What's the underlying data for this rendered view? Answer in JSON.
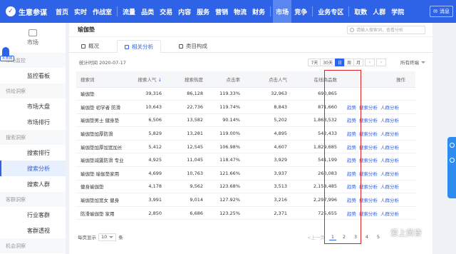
{
  "topnav": {
    "logo": "生意参谋",
    "items": [
      "首页",
      "实时",
      "作战室",
      "流量",
      "品类",
      "交易",
      "内容",
      "服务",
      "营销",
      "物流",
      "财务",
      "市场",
      "竞争",
      "业务专区",
      "取数",
      "人群",
      "学院"
    ],
    "active": "市场",
    "message": "消息"
  },
  "sidebar": {
    "title": "市场",
    "badge": "本质销",
    "groups": [
      {
        "label": "市场监控",
        "items": [
          "监控看板"
        ]
      },
      {
        "label": "供给洞察",
        "items": [
          "市场大盘",
          "市场排行"
        ]
      },
      {
        "label": "搜索洞察",
        "items": [
          "搜索排行",
          "搜索分析",
          "搜索人群"
        ]
      },
      {
        "label": "客群洞察",
        "items": [
          "行业客群",
          "客群透视"
        ]
      },
      {
        "label": "机会洞察",
        "items": []
      }
    ],
    "active_item": "搜索分析"
  },
  "main": {
    "breadcrumb": "瑜伽垫",
    "search_placeholder": "请输入搜索词，查看分析",
    "tabs": [
      "概况",
      "相关分析",
      "类目构成"
    ],
    "active_tab": "相关分析",
    "stat_date": "统计时间 2020-07-17",
    "date_buttons": [
      "7天",
      "30天",
      "日",
      "周",
      "月"
    ],
    "active_date": "日",
    "terminal": "所有终端",
    "table": {
      "headers": [
        "搜索词",
        "搜索人气",
        "搜索热度",
        "点击率",
        "点击人气",
        "在线商品数",
        "操作"
      ],
      "rows": [
        [
          "瑜伽垫",
          "39,316",
          "86,128",
          "119.33%",
          "32,963",
          "690,865",
          ""
        ],
        [
          "瑜伽垫 初学者 防滑",
          "10,643",
          "22,736",
          "119.74%",
          "8,843",
          "871,660",
          "ops"
        ],
        [
          "瑜伽垫男士 健身垫",
          "6,506",
          "13,582",
          "90.14%",
          "5,202",
          "1,863,532",
          "ops"
        ],
        [
          "瑜伽垫加厚防滑",
          "5,829",
          "13,281",
          "119.00%",
          "4,895",
          "542,433",
          "ops"
        ],
        [
          "瑜伽垫加厚加宽加长",
          "5,412",
          "12,545",
          "106.98%",
          "4,607",
          "1,829,685",
          "ops"
        ],
        [
          "瑜伽垫减震防滑 专业",
          "4,925",
          "11,045",
          "118.47%",
          "3,929",
          "541,199",
          "ops"
        ],
        [
          "瑜伽垫 瑜伽垫家用",
          "4,699",
          "10,763",
          "121.66%",
          "3,937",
          "260,083",
          "ops"
        ],
        [
          "健身瑜伽垫",
          "4,178",
          "9,562",
          "123.68%",
          "3,513",
          "2,158,485",
          "ops"
        ],
        [
          "瑜伽垫加宽女 健身",
          "3,991",
          "9,014",
          "127.92%",
          "3,216",
          "2,297,996",
          "ops"
        ],
        [
          "防滑瑜伽垫 家用",
          "2,850",
          "6,686",
          "123.25%",
          "2,371",
          "725,655",
          "ops"
        ]
      ],
      "ops_labels": [
        "趋势",
        "搜索分析",
        "人群分析"
      ]
    },
    "pager": {
      "per_page_label": "每页显示",
      "per_page_value": "10",
      "unit": "条",
      "prev": "<上一页",
      "pages": [
        "1",
        "2",
        "3",
        "4",
        "5"
      ],
      "active_page": "1"
    }
  },
  "watermark": "爱上黄昏",
  "colors": {
    "brand": "#2e63e8",
    "highlight": "#e02020"
  }
}
